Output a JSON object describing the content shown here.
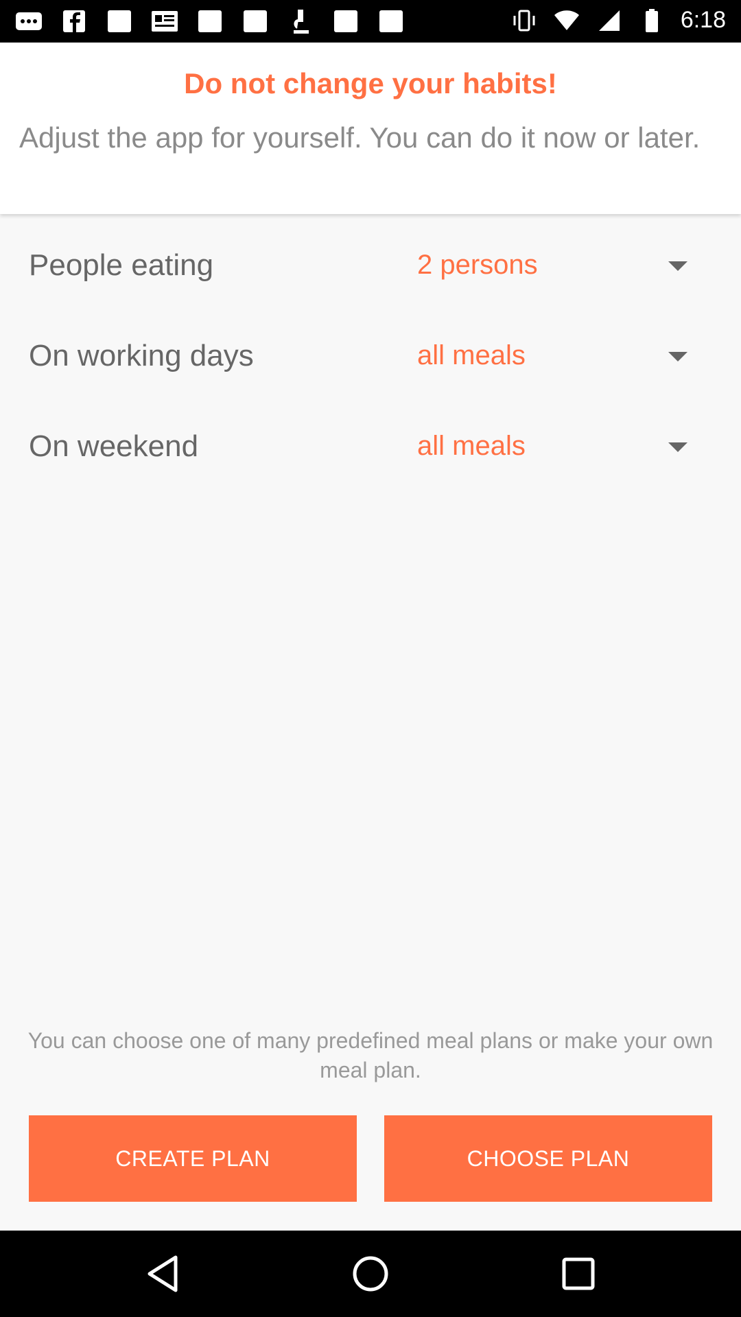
{
  "status_bar": {
    "time": "6:18",
    "icons": [
      "more-icon",
      "facebook-icon",
      "square-icon",
      "news-icon",
      "square-icon",
      "square-icon",
      "microscope-icon",
      "square-icon",
      "square-icon",
      "vibrate-icon",
      "wifi-icon",
      "signal-icon",
      "battery-icon"
    ]
  },
  "header": {
    "title": "Do not change your habits!",
    "subtitle": "Adjust the app for yourself. You can do it now or later."
  },
  "settings": [
    {
      "label": "People eating",
      "value": "2 persons"
    },
    {
      "label": "On working days",
      "value": "all meals"
    },
    {
      "label": "On weekend",
      "value": "all meals"
    }
  ],
  "footer": {
    "text": "You can choose one of many predefined meal plans or make your own meal plan.",
    "create_label": "CREATE PLAN",
    "choose_label": "CHOOSE PLAN"
  },
  "colors": {
    "accent": "#ff7043",
    "label_text": "#666666",
    "muted_text": "#999999"
  },
  "nav_bar": {
    "icons": [
      "back-icon",
      "home-icon",
      "recent-apps-icon"
    ]
  }
}
